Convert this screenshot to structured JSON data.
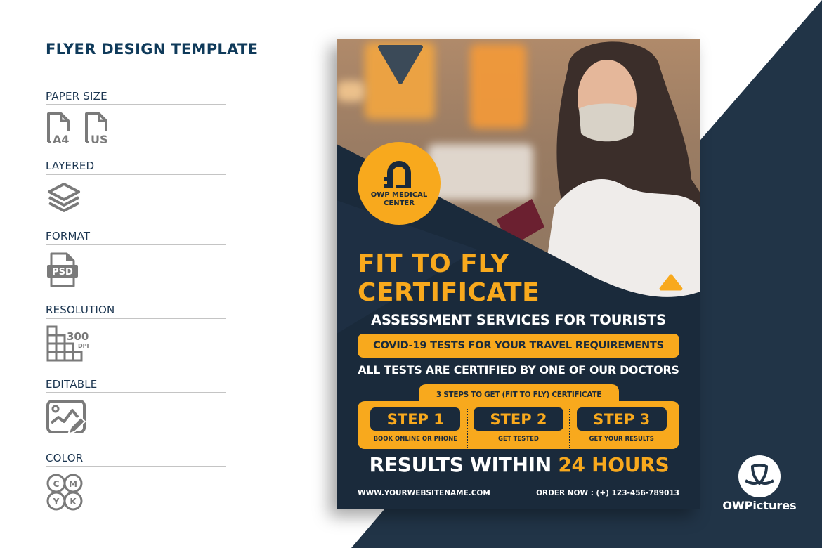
{
  "colors": {
    "navy": "#1a2a3b",
    "background_navy": "#213447",
    "accent_orange": "#f8a91d",
    "title_blue": "#0f3a5a",
    "icon_gray": "#7a7a7a"
  },
  "specs": {
    "title": "FLYER DESIGN TEMPLATE",
    "sections": [
      {
        "label": "PAPER SIZE",
        "icons": [
          {
            "name": "a4-file-icon",
            "text": "A4"
          },
          {
            "name": "us-file-icon",
            "text": "US"
          }
        ]
      },
      {
        "label": "LAYERED",
        "icons": [
          {
            "name": "layers-icon"
          }
        ]
      },
      {
        "label": "FORMAT",
        "icons": [
          {
            "name": "psd-file-icon",
            "text": "PSD"
          }
        ]
      },
      {
        "label": "RESOLUTION",
        "icons": [
          {
            "name": "resolution-300dpi-icon",
            "text": "300",
            "subtext": "DPI"
          }
        ]
      },
      {
        "label": "EDITABLE",
        "icons": [
          {
            "name": "editable-image-icon"
          }
        ]
      },
      {
        "label": "COLOR",
        "icons": [
          {
            "name": "cmyk-icon",
            "letters": [
              "C",
              "M",
              "Y",
              "K"
            ]
          }
        ]
      }
    ]
  },
  "flyer": {
    "logo": {
      "line1": "OWP MEDICAL",
      "line2": "CENTER"
    },
    "headline": {
      "line1": "FIT TO FLY",
      "line2": "CERTIFICATE"
    },
    "subheading": "ASSESSMENT SERVICES FOR TOURISTS",
    "highlight_pill": "COVID-19 TESTS FOR YOUR TRAVEL REQUIREMENTS",
    "certified_line": "ALL TESTS ARE CERTIFIED BY ONE OF OUR DOCTORS",
    "steps_title": "3 STEPS TO GET (FIT TO FLY) CERTIFICATE",
    "steps": [
      {
        "label": "STEP 1",
        "desc": "BOOK ONLINE OR PHONE"
      },
      {
        "label": "STEP 2",
        "desc": "GET TESTED"
      },
      {
        "label": "STEP 3",
        "desc": "GET YOUR RESULTS"
      }
    ],
    "results": {
      "prefix": "RESULTS WITHIN ",
      "highlight": "24 HOURS"
    },
    "website": "WWW.YOURWEBSITENAME.COM",
    "order": "ORDER NOW : (+) 123-456-789013"
  },
  "brand": {
    "name": "OWPictures"
  }
}
